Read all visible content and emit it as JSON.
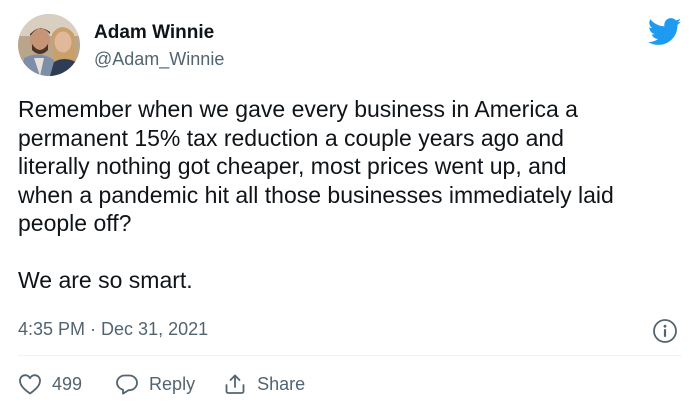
{
  "author": {
    "name": "Adam Winnie",
    "handle": "@Adam_Winnie",
    "avatar_icon": "profile-photo-couple"
  },
  "tweet": {
    "lines": [
      "Remember when we gave every business in America a",
      "permanent 15% tax reduction a couple years ago and",
      "literally nothing got cheaper, most prices went up, and",
      "when a pandemic hit all those businesses immediately laid",
      "people off?"
    ],
    "closing": "We are so smart."
  },
  "meta": {
    "time": "4:35 PM",
    "separator": "·",
    "date": "Dec 31, 2021"
  },
  "actions": {
    "like_count": "499",
    "reply_label": "Reply",
    "share_label": "Share"
  },
  "colors": {
    "twitter_blue": "#1d9bf0",
    "text_primary": "#0f1419",
    "text_secondary": "#536471"
  },
  "icons": {
    "brand": "twitter-bird-icon",
    "info": "info-icon",
    "like": "heart-icon",
    "reply": "speech-bubble-icon",
    "share": "share-upload-icon"
  }
}
